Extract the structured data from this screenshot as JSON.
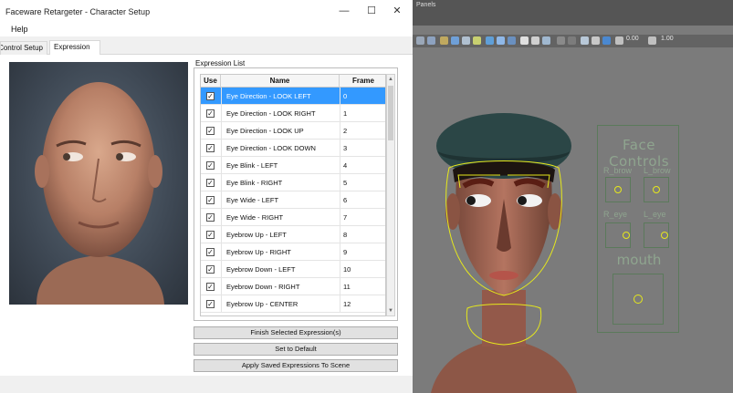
{
  "window": {
    "title": "Faceware Retargeter - Character Setup",
    "minimize": "—",
    "maximize": "☐",
    "close": "✕"
  },
  "menu": {
    "help": "Help"
  },
  "tabs": [
    {
      "label": "Control Setup"
    },
    {
      "label": "Expression Set"
    }
  ],
  "expression_list": {
    "label": "Expression List",
    "columns": {
      "use": "Use",
      "name": "Name",
      "frame": "Frame"
    },
    "rows": [
      {
        "use": true,
        "name": "Eye Direction - LOOK LEFT",
        "frame": "0",
        "selected": true
      },
      {
        "use": true,
        "name": "Eye Direction - LOOK RIGHT",
        "frame": "1"
      },
      {
        "use": true,
        "name": "Eye Direction - LOOK UP",
        "frame": "2"
      },
      {
        "use": true,
        "name": "Eye Direction - LOOK DOWN",
        "frame": "3"
      },
      {
        "use": true,
        "name": "Eye Blink - LEFT",
        "frame": "4"
      },
      {
        "use": true,
        "name": "Eye Blink - RIGHT",
        "frame": "5"
      },
      {
        "use": true,
        "name": "Eye Wide - LEFT",
        "frame": "6"
      },
      {
        "use": true,
        "name": "Eye Wide - RIGHT",
        "frame": "7"
      },
      {
        "use": true,
        "name": "Eyebrow Up - LEFT",
        "frame": "8"
      },
      {
        "use": true,
        "name": "Eyebrow Up - RIGHT",
        "frame": "9"
      },
      {
        "use": true,
        "name": "Eyebrow Down - LEFT",
        "frame": "10"
      },
      {
        "use": true,
        "name": "Eyebrow Down - RIGHT",
        "frame": "11"
      },
      {
        "use": true,
        "name": "Eyebrow Up - CENTER",
        "frame": "12"
      }
    ]
  },
  "buttons": {
    "finish": "Finish Selected Expression(s)",
    "default": "Set to Default",
    "apply": "Apply Saved Expressions To Scene"
  },
  "viewport": {
    "panels_label": "Panels",
    "toolbar_values": {
      "a": "0.00",
      "b": "1.00"
    },
    "face_controls": {
      "title": "Face Controls",
      "r_brow": "R_brow",
      "l_brow": "L_brow",
      "r_eye": "R_eye",
      "l_eye": "L_eye",
      "mouth": "mouth"
    }
  },
  "colors": {
    "selection": "#3399ff",
    "viewport_bg": "#7b7b7b",
    "control_outline": "#e6e81c",
    "face_controls_text": "#8fa58f"
  }
}
